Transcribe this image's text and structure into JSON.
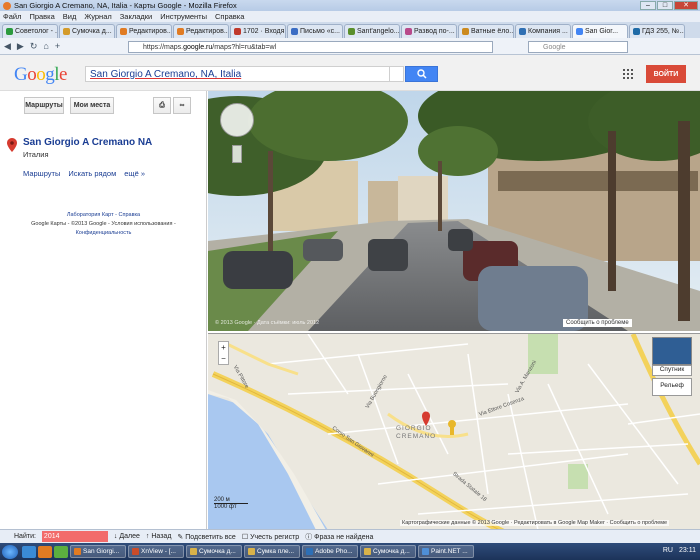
{
  "window": {
    "title": "San Giorgio A Cremano, NA, Italia - Карты Google - Mozilla Firefox",
    "controls": [
      "–",
      "□",
      "✕"
    ]
  },
  "menu": [
    "Файл",
    "Правка",
    "Вид",
    "Журнал",
    "Закладки",
    "Инструменты",
    "Справка"
  ],
  "tabs": [
    {
      "label": "Советолог - ...",
      "color": "#2b9a3e"
    },
    {
      "label": "Сумочка д...",
      "color": "#d49b2a"
    },
    {
      "label": "Редактиров...",
      "color": "#e07b23"
    },
    {
      "label": "Редактиров...",
      "color": "#e07b23"
    },
    {
      "label": "1702 · Входя...",
      "color": "#c0392b"
    },
    {
      "label": "Письмо «с...",
      "color": "#3b6dc4"
    },
    {
      "label": "Sant'angelo...",
      "color": "#5a8f2b"
    },
    {
      "label": "Развод по-...",
      "color": "#b84a8b"
    },
    {
      "label": "Ватные ёло...",
      "color": "#cc8a1e"
    },
    {
      "label": "Компания ...",
      "color": "#2f6fb3"
    },
    {
      "label": "San Gior...",
      "color": "#4285f4"
    },
    {
      "label": "ГДЗ 255, №...",
      "color": "#1f6ba7"
    }
  ],
  "url": {
    "prefix": "https://maps.",
    "domain": "google.ru",
    "path": "/maps?hl=ru&tab=wl"
  },
  "browser_search_placeholder": "Google",
  "google": {
    "logo": "Google",
    "query": "San Giorgio A Cremano, NA, Italia",
    "signin": "ВОЙТИ"
  },
  "left": {
    "btn_routes": "Маршруты",
    "btn_myplaces": "Мои места",
    "place_title": "San Giorgio A Cremano NA",
    "place_sub": "Италия",
    "links": [
      "Маршруты",
      "Искать рядом",
      "ещё »"
    ],
    "footer1": "Лаборатория Карт - Справка",
    "footer2": "Google Карты - ©2013 Google - Условия использования -",
    "footer3": "Конфиденциальность"
  },
  "streetview": {
    "report": "Сообщить о проблеме",
    "copyright": "© 2013 Google · Дата съёмки: июль 2012"
  },
  "map": {
    "town_label": "GIORGIO\nCREMANO",
    "roads": [
      "Corso San Giovanni",
      "Via Buongiorno",
      "Via Pittore",
      "Via A. Manzoni",
      "Via Ettore Cosenza",
      "Strada Statale 18"
    ],
    "satellite": "Спутник",
    "relief": "Рельеф",
    "scale_m": "200 м",
    "scale_ft": "1000 фт",
    "attribution": "Картографические данные © 2013 Google · Редактировать в Google Map Maker · Сообщить о проблеме"
  },
  "findbar": {
    "label": "Найти:",
    "value": "2014",
    "next": "Далее",
    "prev": "Назад",
    "highlight": "Подсветить все",
    "case": "Учесть регистр",
    "status": "Фраза не найдена"
  },
  "taskbar": {
    "tasks": [
      {
        "label": "San Giorgi...",
        "color": "#e07b23"
      },
      {
        "label": "XnView - [...",
        "color": "#c94c2a"
      },
      {
        "label": "Сумочка д...",
        "color": "#d8b24a"
      },
      {
        "label": "Сумка пле...",
        "color": "#d8b24a"
      },
      {
        "label": "Adobe Pho...",
        "color": "#2d6fb6"
      },
      {
        "label": "Сумочка д...",
        "color": "#d8b24a"
      },
      {
        "label": "Paint.NET ...",
        "color": "#4f8fd6"
      }
    ],
    "lang": "RU",
    "time": "23:11"
  }
}
